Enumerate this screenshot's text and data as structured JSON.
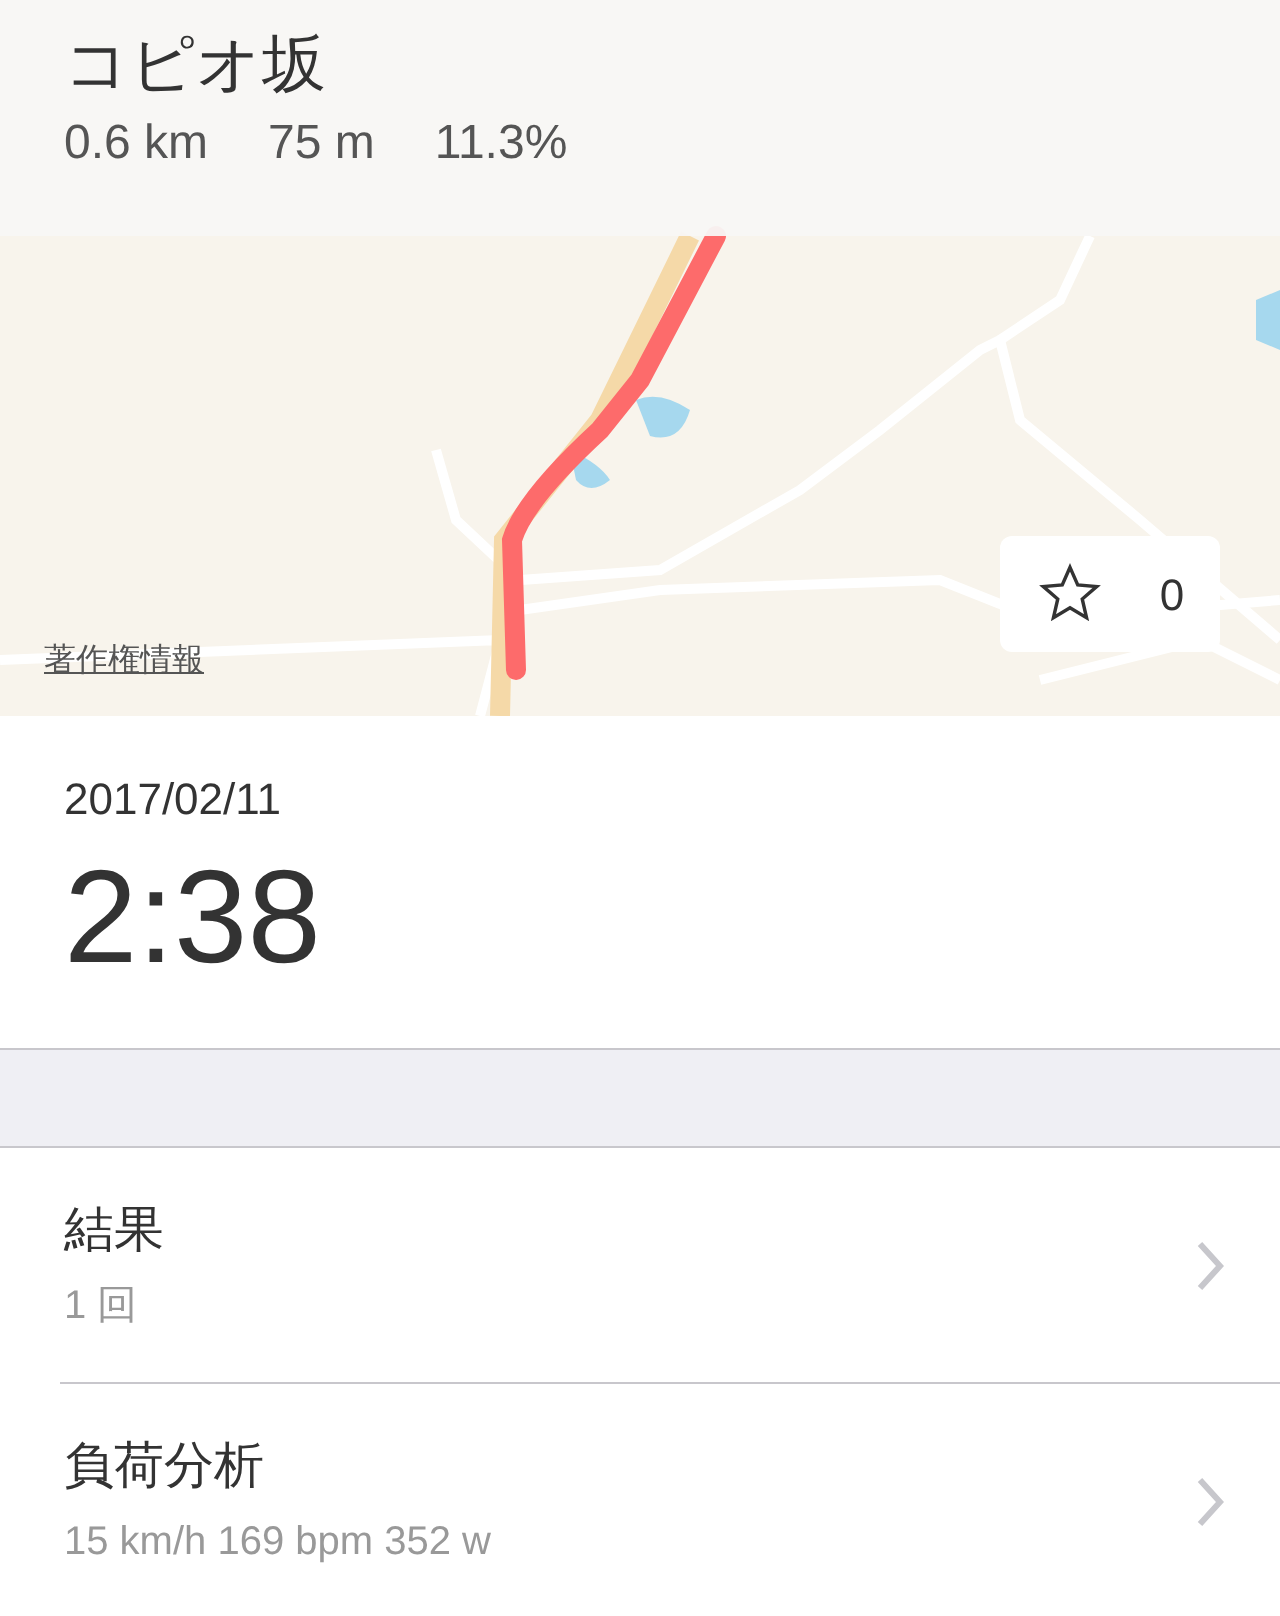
{
  "segment": {
    "name": "コピオ坂",
    "stats": [
      "0.6 km",
      "75 m",
      "11.3%"
    ]
  },
  "map": {
    "legal_link": "著作権情報",
    "favorite_count": "0"
  },
  "summary": {
    "date": "2017/02/11",
    "time": "2:38"
  },
  "rows": [
    {
      "title": "結果",
      "detail": "1 回"
    },
    {
      "title": "負荷分析",
      "detail": "15 km/h 169 bpm 352 w"
    }
  ]
}
